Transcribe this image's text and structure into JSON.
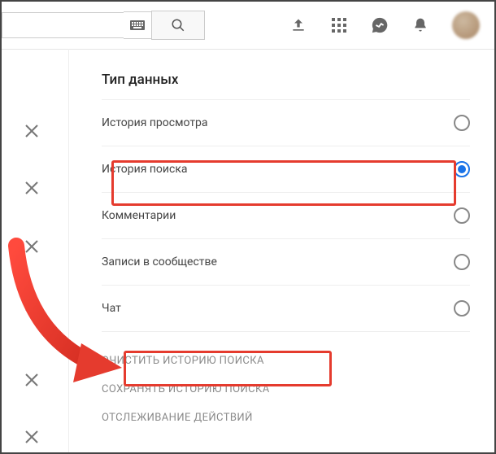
{
  "search": {
    "value": "",
    "placeholder": ""
  },
  "section_title": "Тип данных",
  "options": [
    {
      "label": "История просмотра",
      "selected": false
    },
    {
      "label": "История поиска",
      "selected": true
    },
    {
      "label": "Комментарии",
      "selected": false
    },
    {
      "label": "Записи в сообществе",
      "selected": false
    },
    {
      "label": "Чат",
      "selected": false
    }
  ],
  "actions": [
    "ОЧИСТИТЬ ИСТОРИЮ ПОИСКА",
    "СОХРАНЯТЬ ИСТОРИЮ ПОИСКА",
    "ОТСЛЕЖИВАНИЕ ДЕЙСТВИЙ"
  ]
}
